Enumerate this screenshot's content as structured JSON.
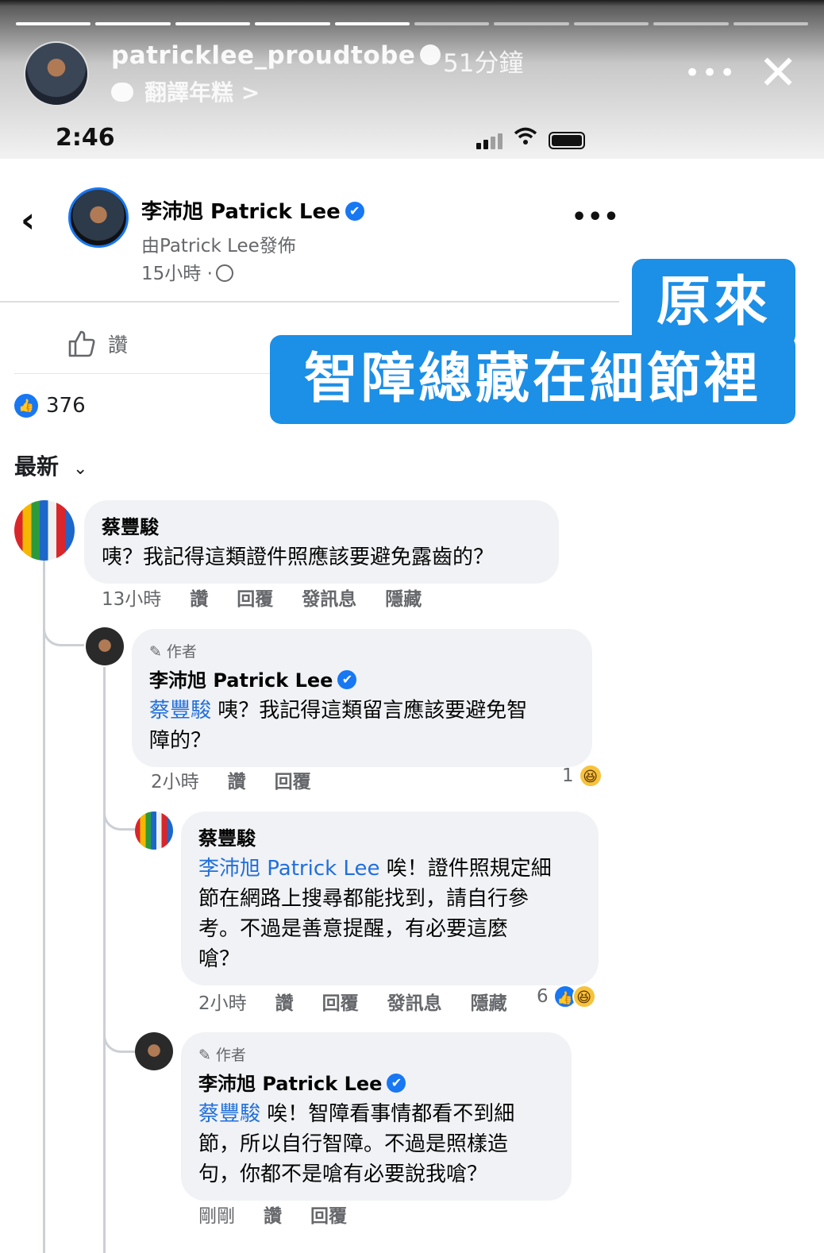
{
  "story": {
    "username": "patricklee_proudtobe",
    "time_ago": "51分鐘",
    "subtitle": "翻譯年糕 >",
    "more": "•••",
    "close": "✕"
  },
  "status_bar": {
    "time": "2:46"
  },
  "post": {
    "back": "‹",
    "page_name": "李沛旭 Patrick Lee",
    "posted_by": "由Patrick Lee發佈",
    "time": "15小時 ·",
    "more": "•••",
    "like_action": "讚",
    "reaction_count": "376",
    "sort_label": "最新"
  },
  "caption": {
    "line1": "原來",
    "line2": "智障總藏在細節裡"
  },
  "comments": [
    {
      "author": "蔡豐駿",
      "text": "咦？我記得這類證件照應該要避免露齒的？",
      "time": "13小時",
      "actions": [
        "讚",
        "回覆",
        "發訊息",
        "隱藏"
      ]
    },
    {
      "author_badge": "作者",
      "author": "李沛旭 Patrick Lee",
      "tag": "蔡豐駿",
      "text_line1": " 咦？我記得這類留言應該要避免智",
      "text_line2": "障的？",
      "time": "2小時",
      "actions": [
        "讚",
        "回覆"
      ],
      "reactions": "1"
    },
    {
      "author": "蔡豐駿",
      "tag": "李沛旭 Patrick Lee",
      "text_line1": " 唉！證件照規定細",
      "text_line2": "節在網路上搜尋都能找到，請自行參",
      "text_line3": "考。不過是善意提醒，有必要這麼",
      "text_line4": "嗆？",
      "time": "2小時",
      "actions": [
        "讚",
        "回覆",
        "發訊息",
        "隱藏"
      ],
      "reactions": "6"
    },
    {
      "author_badge": "作者",
      "author": "李沛旭 Patrick Lee",
      "tag": "蔡豐駿",
      "text_line1": " 唉！智障看事情都看不到細",
      "text_line2": "節，所以自行智障。不過是照樣造",
      "text_line3": "句，你都不是嗆有必要說我嗆？",
      "time": "剛剛",
      "actions": [
        "讚",
        "回覆"
      ]
    }
  ],
  "icons": {
    "verified": "✔",
    "like": "👍",
    "laugh": "😆",
    "pen": "✎",
    "chevron": "⌄",
    "wifi": "◠"
  }
}
